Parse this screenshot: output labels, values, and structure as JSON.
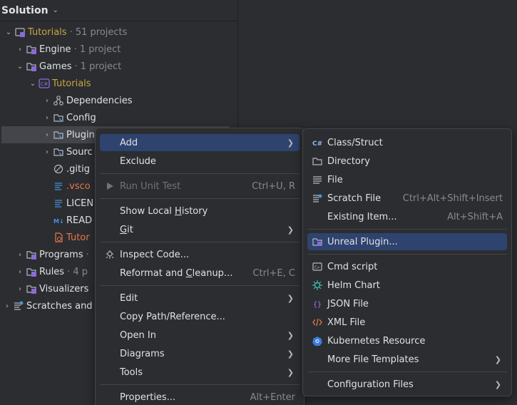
{
  "panel": {
    "title": "Solution"
  },
  "tree": {
    "tutorials_root": {
      "label": "Tutorials",
      "meta": "· 51 projects"
    },
    "engine": {
      "label": "Engine",
      "meta": "· 1 project"
    },
    "games": {
      "label": "Games",
      "meta": "· 1 project"
    },
    "tutorials_proj": {
      "label": "Tutorials"
    },
    "dependencies": {
      "label": "Dependencies"
    },
    "config": {
      "label": "Config"
    },
    "plugins": {
      "label": "Plugin"
    },
    "source": {
      "label": "Sourc"
    },
    "gitignore": {
      "label": ".gitig"
    },
    "vscode": {
      "label": ".vsco"
    },
    "license": {
      "label": "LICEN"
    },
    "readme": {
      "label": "READ"
    },
    "tutor": {
      "label": "Tutor"
    },
    "programs": {
      "label": "Programs",
      "meta": "·"
    },
    "rules": {
      "label": "Rules",
      "meta": "· 4 p"
    },
    "visualizers": {
      "label": "Visualizers"
    },
    "scratches": {
      "label": "Scratches and"
    }
  },
  "context_menu": {
    "add": "Add",
    "exclude": "Exclude",
    "run_unit_test": "Run Unit Test",
    "run_unit_test_shortcut": "Ctrl+U, R",
    "show_local_history_pre": "Show Local ",
    "show_local_history_u": "H",
    "show_local_history_post": "istory",
    "git_u": "G",
    "git_post": "it",
    "inspect_code": "Inspect Code...",
    "reformat_pre": "Reformat and ",
    "reformat_u": "C",
    "reformat_post": "leanup...",
    "reformat_shortcut": "Ctrl+E, C",
    "edit": "Edit",
    "copy_path": "Copy Path/Reference...",
    "open_in": "Open In",
    "diagrams": "Diagrams",
    "tools": "Tools",
    "properties": "Properties...",
    "properties_shortcut": "Alt+Enter"
  },
  "submenu": {
    "class_struct": "Class/Struct",
    "directory": "Directory",
    "file": "File",
    "scratch_file": "Scratch File",
    "scratch_file_shortcut": "Ctrl+Alt+Shift+Insert",
    "existing_item": "Existing Item...",
    "existing_item_shortcut": "Alt+Shift+A",
    "unreal_plugin": "Unreal Plugin...",
    "cmd_script": "Cmd script",
    "helm_chart": "Helm Chart",
    "json_file": "JSON File",
    "xml_file": "XML File",
    "kubernetes_resource": "Kubernetes Resource",
    "more_file_templates": "More File Templates",
    "configuration_files": "Configuration Files"
  },
  "colors": {
    "accent_selection": "#2e436e",
    "background": "#2b2d30",
    "folder_yellow": "#c9a541",
    "vcs_red": "#e8754a"
  }
}
